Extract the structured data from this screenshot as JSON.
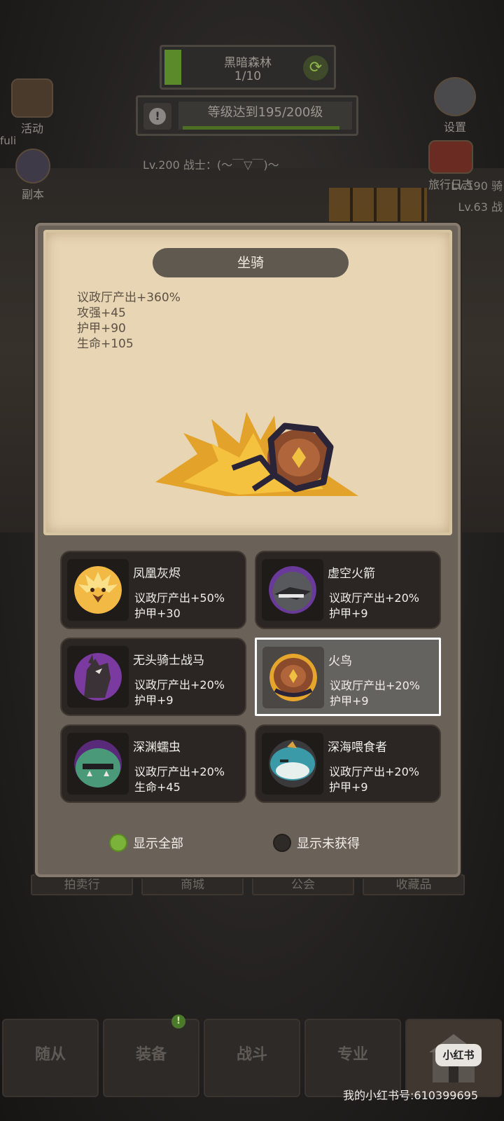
{
  "hud": {
    "stage_name": "黑暗森林",
    "stage_count": "1/10",
    "stage_progress": 0.1,
    "quest_text": "等级达到195/200级",
    "quest_progress": 0.975,
    "player_line": "Lv.200 战士：(～￣▽￣)～",
    "left_icons": [
      {
        "label": "活动",
        "icon": "activity-scroll-icon"
      },
      {
        "label": "副本",
        "icon": "dungeon-portal-icon"
      }
    ],
    "fuli_label": "fuli",
    "right_icons": [
      {
        "label": "设置",
        "icon": "gear-icon"
      },
      {
        "label": "旅行日志",
        "icon": "travel-log-book-icon"
      }
    ],
    "right_line1": "Lv.190 骑",
    "right_line2": "Lv.63 战"
  },
  "modal": {
    "title": "坐骑",
    "stats": [
      "议政厅产出+360%",
      "攻强+45",
      "护甲+90",
      "生命+105"
    ],
    "mounts": [
      {
        "name": "凤凰灰烬",
        "stat1": "议政厅产出+50%",
        "stat2": "护甲+30",
        "selected": false
      },
      {
        "name": "虚空火箭",
        "stat1": "议政厅产出+20%",
        "stat2": "护甲+9",
        "selected": false
      },
      {
        "name": "无头骑士战马",
        "stat1": "议政厅产出+20%",
        "stat2": "护甲+9",
        "selected": false
      },
      {
        "name": "火鸟",
        "stat1": "议政厅产出+20%",
        "stat2": "护甲+9",
        "selected": true
      },
      {
        "name": "深渊蠕虫",
        "stat1": "议政厅产出+20%",
        "stat2": "生命+45",
        "selected": false
      },
      {
        "name": "深海喂食者",
        "stat1": "议政厅产出+20%",
        "stat2": "护甲+9",
        "selected": false
      }
    ],
    "filter_all": "显示全部",
    "filter_unowned": "显示未获得",
    "filter_all_selected": true
  },
  "bg_menu": [
    "拍卖行",
    "商城",
    "公会",
    "收藏品"
  ],
  "bottom_nav": {
    "items": [
      "随从",
      "装备",
      "战斗",
      "专业"
    ],
    "badge": "!"
  },
  "watermark": {
    "logo": "小红书",
    "text": "我的小红书号:610399695"
  },
  "colors": {
    "parchment": "#e7d5b4",
    "panel": "#6a6158",
    "card": "#2b2623",
    "selected_card": "#656360",
    "radio_on": "#7bb23a"
  }
}
